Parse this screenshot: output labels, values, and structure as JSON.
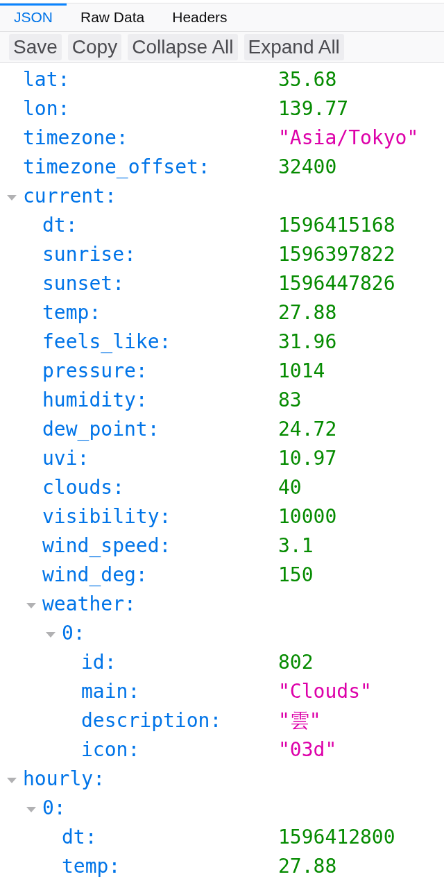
{
  "tabs": [
    {
      "label": "JSON",
      "selected": true
    },
    {
      "label": "Raw Data",
      "selected": false
    },
    {
      "label": "Headers",
      "selected": false
    }
  ],
  "toolbar": {
    "buttons": [
      "Save",
      "Copy",
      "Collapse All",
      "Expand All"
    ]
  },
  "tree": [
    {
      "key": "lat:",
      "kind": "number",
      "value": "35.68"
    },
    {
      "key": "lon:",
      "kind": "number",
      "value": "139.77"
    },
    {
      "key": "timezone:",
      "kind": "string",
      "value": "\"Asia/Tokyo\""
    },
    {
      "key": "timezone_offset:",
      "kind": "number",
      "value": "32400"
    },
    {
      "key": "current:",
      "kind": "object",
      "expanded": true,
      "children": [
        {
          "key": "dt:",
          "kind": "number",
          "value": "1596415168"
        },
        {
          "key": "sunrise:",
          "kind": "number",
          "value": "1596397822"
        },
        {
          "key": "sunset:",
          "kind": "number",
          "value": "1596447826"
        },
        {
          "key": "temp:",
          "kind": "number",
          "value": "27.88"
        },
        {
          "key": "feels_like:",
          "kind": "number",
          "value": "31.96"
        },
        {
          "key": "pressure:",
          "kind": "number",
          "value": "1014"
        },
        {
          "key": "humidity:",
          "kind": "number",
          "value": "83"
        },
        {
          "key": "dew_point:",
          "kind": "number",
          "value": "24.72"
        },
        {
          "key": "uvi:",
          "kind": "number",
          "value": "10.97"
        },
        {
          "key": "clouds:",
          "kind": "number",
          "value": "40"
        },
        {
          "key": "visibility:",
          "kind": "number",
          "value": "10000"
        },
        {
          "key": "wind_speed:",
          "kind": "number",
          "value": "3.1"
        },
        {
          "key": "wind_deg:",
          "kind": "number",
          "value": "150"
        },
        {
          "key": "weather:",
          "kind": "object",
          "expanded": true,
          "children": [
            {
              "key": "0:",
              "kind": "object",
              "expanded": true,
              "children": [
                {
                  "key": "id:",
                  "kind": "number",
                  "value": "802"
                },
                {
                  "key": "main:",
                  "kind": "string",
                  "value": "\"Clouds\""
                },
                {
                  "key": "description:",
                  "kind": "string",
                  "value": "\"雲\""
                },
                {
                  "key": "icon:",
                  "kind": "string",
                  "value": "\"03d\""
                }
              ]
            }
          ]
        }
      ]
    },
    {
      "key": "hourly:",
      "kind": "object",
      "expanded": true,
      "children": [
        {
          "key": "0:",
          "kind": "object",
          "expanded": true,
          "children": [
            {
              "key": "dt:",
              "kind": "number",
              "value": "1596412800"
            },
            {
              "key": "temp:",
              "kind": "number",
              "value": "27.88"
            }
          ]
        }
      ]
    }
  ]
}
